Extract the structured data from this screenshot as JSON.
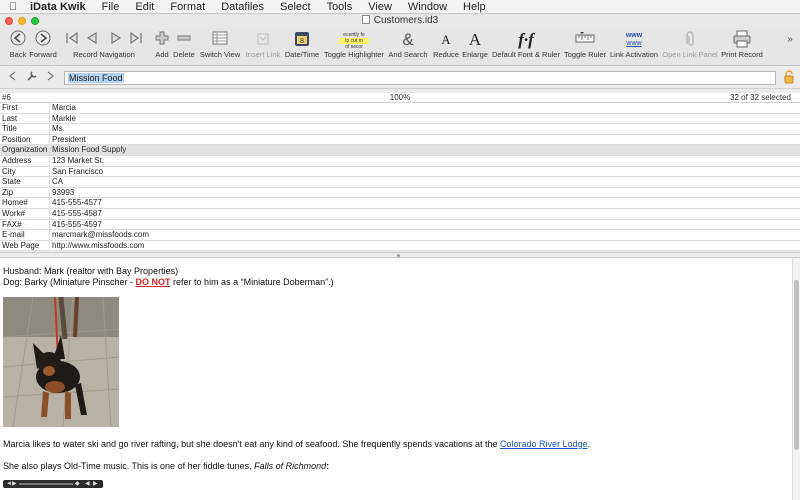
{
  "menu": {
    "app_name": "iData Kwik",
    "items": [
      "File",
      "Edit",
      "Format",
      "Datafiles",
      "Select",
      "Tools",
      "View",
      "Window",
      "Help"
    ]
  },
  "window": {
    "title": "Customers.id3"
  },
  "toolbar": {
    "back": "Back",
    "forward": "Forward",
    "record_navigation": "Record Navigation",
    "add": "Add",
    "delete": "Delete",
    "switch_view": "Switch View",
    "insert_link": "Insert Link",
    "date_time": "Date/Time",
    "toggle_highlighter": "Toggle Highlighter",
    "highlighter_sample": [
      "ecently fe",
      "to cut m",
      "of secor"
    ],
    "and_search": "And Search",
    "reduce": "Reduce",
    "enlarge": "Enlarge",
    "default_font_ruler": "Default Font & Ruler",
    "toggle_ruler": "Toggle Ruler",
    "link_activation": "Link Activation",
    "open_link_panel": "Open Link Panel",
    "print_record": "Print Record",
    "calendar_day": "8",
    "link_sample": "www"
  },
  "address": {
    "value": "Mission Food"
  },
  "status": {
    "record": "#6",
    "zoom": "100%",
    "selected": "32 of 32 selected"
  },
  "fields": [
    {
      "label": "First",
      "value": "Marcia"
    },
    {
      "label": "Last",
      "value": "Markle"
    },
    {
      "label": "Title",
      "value": "Ms."
    },
    {
      "label": "Position",
      "value": "President"
    },
    {
      "label": "Organization",
      "value": "Mission Food Supply"
    },
    {
      "label": "Address",
      "value": "123 Market St."
    },
    {
      "label": "City",
      "value": "San Francisco"
    },
    {
      "label": "State",
      "value": "CA"
    },
    {
      "label": "Zip",
      "value": "93993"
    },
    {
      "label": "Home#",
      "value": "415-555-4577"
    },
    {
      "label": "Work#",
      "value": "415-555-4587"
    },
    {
      "label": "FAX#",
      "value": "415-555-4597"
    },
    {
      "label": "E-mail",
      "value": "marcmark@missfoods.com"
    },
    {
      "label": "Web Page",
      "value": "http://www.missfoods.com"
    }
  ],
  "notes": {
    "line1": "Husband: Mark (realtor with Bay Properties)",
    "line2_pre": "Dog: Barky (Miniature Pinscher - ",
    "line2_warn": "DO NOT",
    "line2_post": " refer to him as a “Miniature Doberman”.)",
    "line3_pre": "Marcia likes to water ski and go river rafting, but she doesn't eat any kind of seafood. She frequently spends vacations at the ",
    "line3_link": "Colorado River Lodge",
    "line3_post": ".",
    "line4_pre": "She also plays Old-Time music. This is one of her fiddle tunes, ",
    "line4_italic": "Falls of Richmond",
    "line4_post": ":"
  },
  "colors": {
    "warning": "#d12a2a",
    "link": "#1a55c9",
    "selection": "#b4d3f4",
    "highlight_row": "#e2e2e2"
  }
}
